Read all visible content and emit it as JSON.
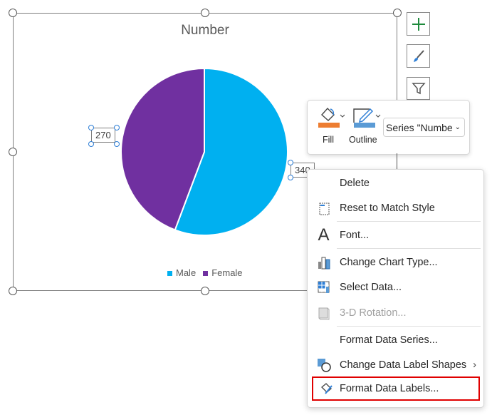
{
  "chart_data": {
    "type": "pie",
    "title": "Number",
    "categories": [
      "Male",
      "Female"
    ],
    "values": [
      340,
      270
    ],
    "colors": [
      "#00b0f0",
      "#7030a0"
    ],
    "data_labels": [
      "340",
      "270"
    ],
    "legend": "bottom"
  },
  "toolbar": {
    "fill_label": "Fill",
    "outline_label": "Outline",
    "series_select": "Series \"Numbe",
    "fill_color": "#ed7d31",
    "outline_color": "#5b9bd5"
  },
  "menu": {
    "items": [
      {
        "label": "Delete",
        "icon": "none"
      },
      {
        "label": "Reset to Match Style",
        "icon": "reset-icon"
      },
      {
        "label": "Font...",
        "icon": "font-icon"
      },
      {
        "label": "Change Chart Type...",
        "icon": "chart-type-icon"
      },
      {
        "label": "Select Data...",
        "icon": "select-data-icon"
      },
      {
        "label": "3-D Rotation...",
        "icon": "3d-rotation-icon",
        "disabled": true
      },
      {
        "label": "Format Data Series...",
        "icon": "none"
      },
      {
        "label": "Change Data Label Shapes",
        "icon": "shapes-icon",
        "submenu": true
      },
      {
        "label": "Format Data Labels...",
        "icon": "format-labels-icon",
        "highlighted": true
      }
    ]
  },
  "highlight_color": "#e00000"
}
